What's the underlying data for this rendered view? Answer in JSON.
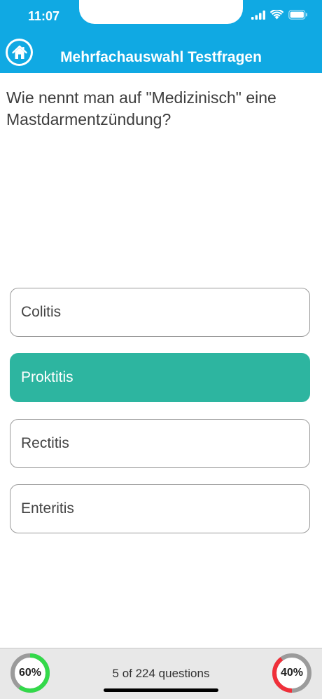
{
  "status_bar": {
    "time": "11:07",
    "icons": [
      "cellular-signal-icon",
      "wifi-icon",
      "battery-icon"
    ]
  },
  "header": {
    "title": "Mehrfachauswahl Testfragen",
    "home_icon": "home-icon",
    "color": "#10a9e3"
  },
  "question": {
    "text": "Wie nennt man auf \"Medizinisch\" eine Mastdarmentzündung?"
  },
  "answers": [
    {
      "label": "Colitis",
      "state": "default"
    },
    {
      "label": "Proktitis",
      "state": "correct"
    },
    {
      "label": "Rectitis",
      "state": "default"
    },
    {
      "label": "Enteritis",
      "state": "default"
    }
  ],
  "footer": {
    "progress_text": "5 of 224 questions",
    "correct_ring": {
      "label": "60%",
      "value": 60,
      "color": "#33d94a"
    },
    "wrong_ring": {
      "label": "40%",
      "value": 40,
      "color": "#f0303a"
    }
  },
  "colors": {
    "accent": "#10a9e3",
    "correct_answer": "#2db5a0"
  }
}
